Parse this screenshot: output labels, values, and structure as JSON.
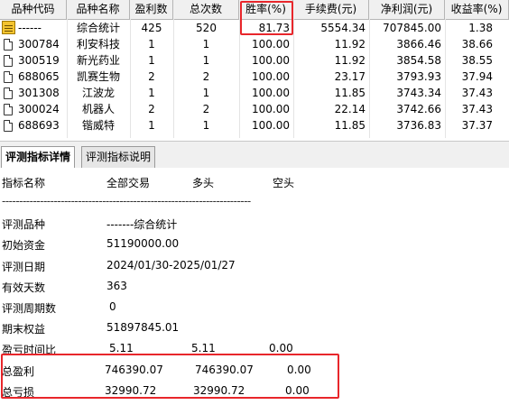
{
  "table": {
    "headers": [
      "品种代码",
      "品种名称",
      "盈利数",
      "总次数",
      "胜率(%)",
      "手续费(元)",
      "净利润(元)",
      "收益率(%)"
    ],
    "rows": [
      {
        "code": "------",
        "name": "综合统计",
        "wins": "425",
        "total": "520",
        "rate": "81.73",
        "fee": "5554.34",
        "profit": "707845.00",
        "ret": "1.38",
        "icon": "summary-icon"
      },
      {
        "code": "300784",
        "name": "利安科技",
        "wins": "1",
        "total": "1",
        "rate": "100.00",
        "fee": "11.92",
        "profit": "3866.46",
        "ret": "38.66",
        "icon": "document-icon"
      },
      {
        "code": "300519",
        "name": "新光药业",
        "wins": "1",
        "total": "1",
        "rate": "100.00",
        "fee": "11.92",
        "profit": "3854.58",
        "ret": "38.55",
        "icon": "document-icon"
      },
      {
        "code": "688065",
        "name": "凯赛生物",
        "wins": "2",
        "total": "2",
        "rate": "100.00",
        "fee": "23.17",
        "profit": "3793.93",
        "ret": "37.94",
        "icon": "document-icon"
      },
      {
        "code": "301308",
        "name": "江波龙",
        "wins": "1",
        "total": "1",
        "rate": "100.00",
        "fee": "11.85",
        "profit": "3743.34",
        "ret": "37.43",
        "icon": "document-icon"
      },
      {
        "code": "300024",
        "name": "机器人",
        "wins": "2",
        "total": "2",
        "rate": "100.00",
        "fee": "22.14",
        "profit": "3742.66",
        "ret": "37.43",
        "icon": "document-icon"
      },
      {
        "code": "688693",
        "name": "锴威特",
        "wins": "1",
        "total": "1",
        "rate": "100.00",
        "fee": "11.85",
        "profit": "3736.83",
        "ret": "37.37",
        "icon": "document-icon"
      }
    ]
  },
  "tabs": [
    "评测指标详情",
    "评测指标说明"
  ],
  "report": {
    "header": {
      "name": "指标名称",
      "all": "全部交易",
      "long": "多头",
      "short": "空头"
    },
    "divider": "------------------------------------------------------------------------",
    "variety_label": "评测品种",
    "variety_value": "-------综合统计",
    "capital_label": "初始资金",
    "capital_value": "51190000.00",
    "date_label": "评测日期",
    "date_value": "2024/01/30-2025/01/27",
    "days_label": "有效天数",
    "days_value": "363",
    "periods_label": "评测周期数",
    "periods_value": "0",
    "equity_label": "期末权益",
    "equity_value": "51897845.01",
    "ratio_label": "盈亏时间比",
    "ratio_all": "5.11",
    "ratio_long": "5.11",
    "ratio_short": "0.00",
    "gain_label": "总盈利",
    "gain_all": "746390.07",
    "gain_long": "746390.07",
    "gain_short": "0.00",
    "loss_label": "总亏损",
    "loss_all": "32990.72",
    "loss_long": "32990.72",
    "loss_short": "0.00"
  },
  "colors": {
    "highlight_box": "#e8262b",
    "header_bg": "#f0f0f0"
  }
}
